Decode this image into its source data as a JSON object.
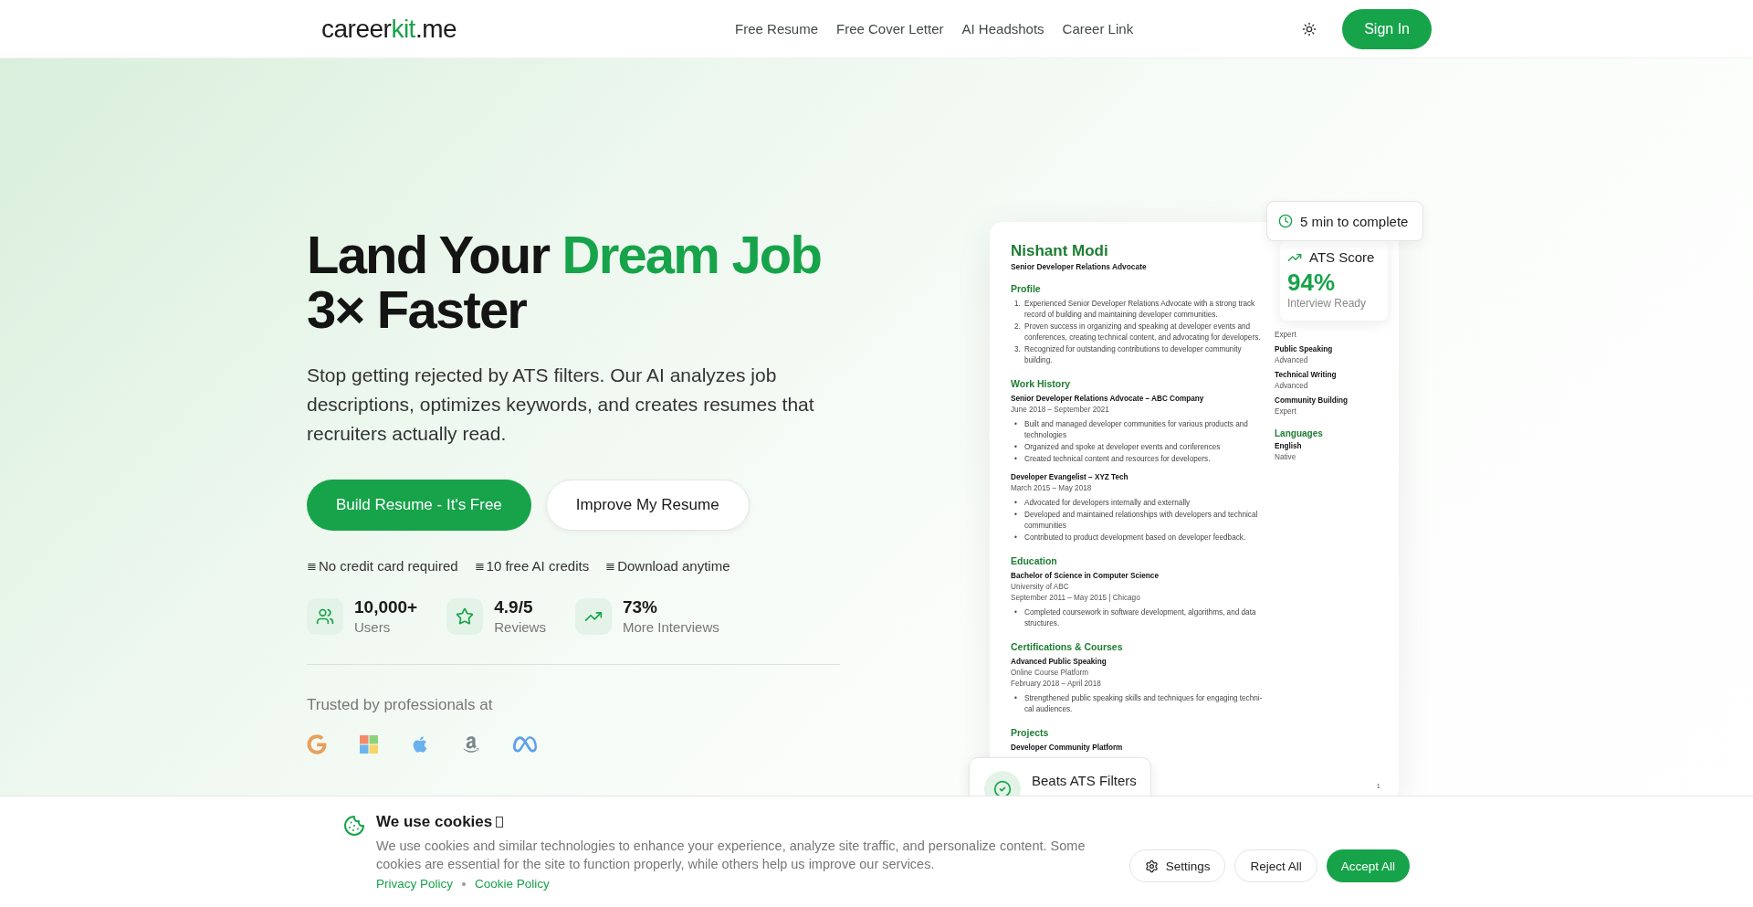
{
  "header": {
    "logo": [
      {
        "text": "career",
        "accent": false
      },
      {
        "text": "kit",
        "accent": true
      },
      {
        "text": ".me",
        "accent": false
      }
    ],
    "nav": [
      "Free Resume",
      "Free Cover Letter",
      "AI Headshots",
      "Career Link"
    ],
    "sign_in": "Sign In"
  },
  "hero": {
    "title": [
      {
        "text": "Land Your ",
        "accent": false,
        "break": false
      },
      {
        "text": "Dream Job",
        "accent": true,
        "break": false
      },
      {
        "text": "3× Faster",
        "accent": false,
        "break": true
      }
    ],
    "subtitle": "Stop getting rejected by ATS filters. Our AI analyzes job descriptions, optimizes keywords, and creates resumes that recruiters actually read.",
    "buttons": [
      {
        "label": "Build Resume - It's Free",
        "kind": "primary"
      },
      {
        "label": "Improve My Resume",
        "kind": "secondary"
      }
    ],
    "perks": [
      {
        "mark": "≣",
        "text": "No credit card required"
      },
      {
        "mark": "≣",
        "text": "10 free AI credits"
      },
      {
        "mark": "≣",
        "text": "Download anytime"
      }
    ],
    "stats": [
      {
        "kind": "users",
        "value": "10,000+",
        "label": "Users"
      },
      {
        "kind": "star",
        "value": "4.9/5",
        "label": "Reviews"
      },
      {
        "kind": "trend",
        "value": "73%",
        "label": "More Interviews"
      }
    ],
    "trusted": "Trusted by professionals at",
    "logos": [
      {
        "kind": "google"
      },
      {
        "kind": "microsoft"
      },
      {
        "kind": "apple"
      },
      {
        "kind": "amazon"
      },
      {
        "kind": "meta"
      }
    ]
  },
  "resume": {
    "name": "Nishant Modi",
    "title": "Senior Developer Relations Advocate",
    "sections": [
      {
        "heading": "Profile",
        "kind": "numbered",
        "items": [
          {
            "marker": "1.",
            "text": "Experienced Senior Developer Relations Advocate with a strong track record of building and maintaining developer communities."
          },
          {
            "marker": "2.",
            "text": "Proven success in organizing and speaking at developer events and conferences, creating technical content, and advocating for developers."
          },
          {
            "marker": "3.",
            "text": "Recognized for outstanding contributions to developer community building."
          }
        ]
      },
      {
        "heading": "Work History",
        "kind": "entries",
        "entries": [
          {
            "title": "Senior Developer Relations Advocate – ABC Company",
            "lines": [
              "June 2018 – September 2021"
            ],
            "bullets": [
              {
                "marker": "•",
                "text": "Built and managed developer communities for various products and technologies"
              },
              {
                "marker": "•",
                "text": "Organized and spoke at developer events and conferences"
              },
              {
                "marker": "•",
                "text": "Created technical content and resources for developers."
              }
            ]
          },
          {
            "title": "Developer Evangelist – XYZ Tech",
            "lines": [
              "March 2015 – May 2018"
            ],
            "bullets": [
              {
                "marker": "•",
                "text": "Advocated for developers internally and externally"
              },
              {
                "marker": "•",
                "text": "Developed and maintained relationships with developers and technical communities"
              },
              {
                "marker": "•",
                "text": "Contributed to product development based on developer feedback."
              }
            ]
          }
        ]
      },
      {
        "heading": "Education",
        "kind": "entries",
        "entries": [
          {
            "title": "Bachelor of Science in Computer Science",
            "lines": [
              "University of ABC",
              "September 2011 – May 2015 | Chicago"
            ],
            "bullets": [
              {
                "marker": "•",
                "text": "Completed coursework in software development, algorithms, and data structures."
              }
            ]
          }
        ]
      },
      {
        "heading": "Certifications & Courses",
        "kind": "entries",
        "entries": [
          {
            "title": "Advanced Public Speaking",
            "lines": [
              "Online Course Platform",
              "February 2018 – April 2018"
            ],
            "bullets": [
              {
                "marker": "•",
                "text": "Strengthened public speaking skills and techniques for engaging techni-cal audiences."
              }
            ]
          }
        ]
      },
      {
        "heading": "Projects",
        "kind": "entries",
        "entries": [
          {
            "title": "Developer Community Platform"
          }
        ]
      }
    ],
    "side": [
      {
        "items": [
          {
            "level": "Expert"
          },
          {
            "name": "Public Speaking",
            "level": "Advanced"
          },
          {
            "name": "Technical Writing",
            "level": "Advanced"
          },
          {
            "name": "Community Building",
            "level": "Expert"
          }
        ]
      },
      {
        "heading": "Languages",
        "items": [
          {
            "name": "English",
            "level": "Native"
          }
        ]
      }
    ],
    "page": "1"
  },
  "badges": {
    "time": "5 min to complete",
    "ats_label": "ATS Score",
    "ats_value": "94%",
    "ats_caption": "Interview Ready",
    "beats": "Beats ATS Filters"
  },
  "cookies": {
    "title": "We use cookies",
    "text": "We use cookies and similar technologies to enhance your experience, analyze site traffic, and personalize content. Some cookies are essential for the site to function properly, while others help us improve our services.",
    "links": [
      "Privacy Policy",
      "Cookie Policy"
    ],
    "buttons": [
      {
        "label": "Settings",
        "kind": "settings"
      },
      {
        "label": "Reject All",
        "kind": "outline"
      },
      {
        "label": "Accept All",
        "kind": "primary"
      }
    ]
  }
}
